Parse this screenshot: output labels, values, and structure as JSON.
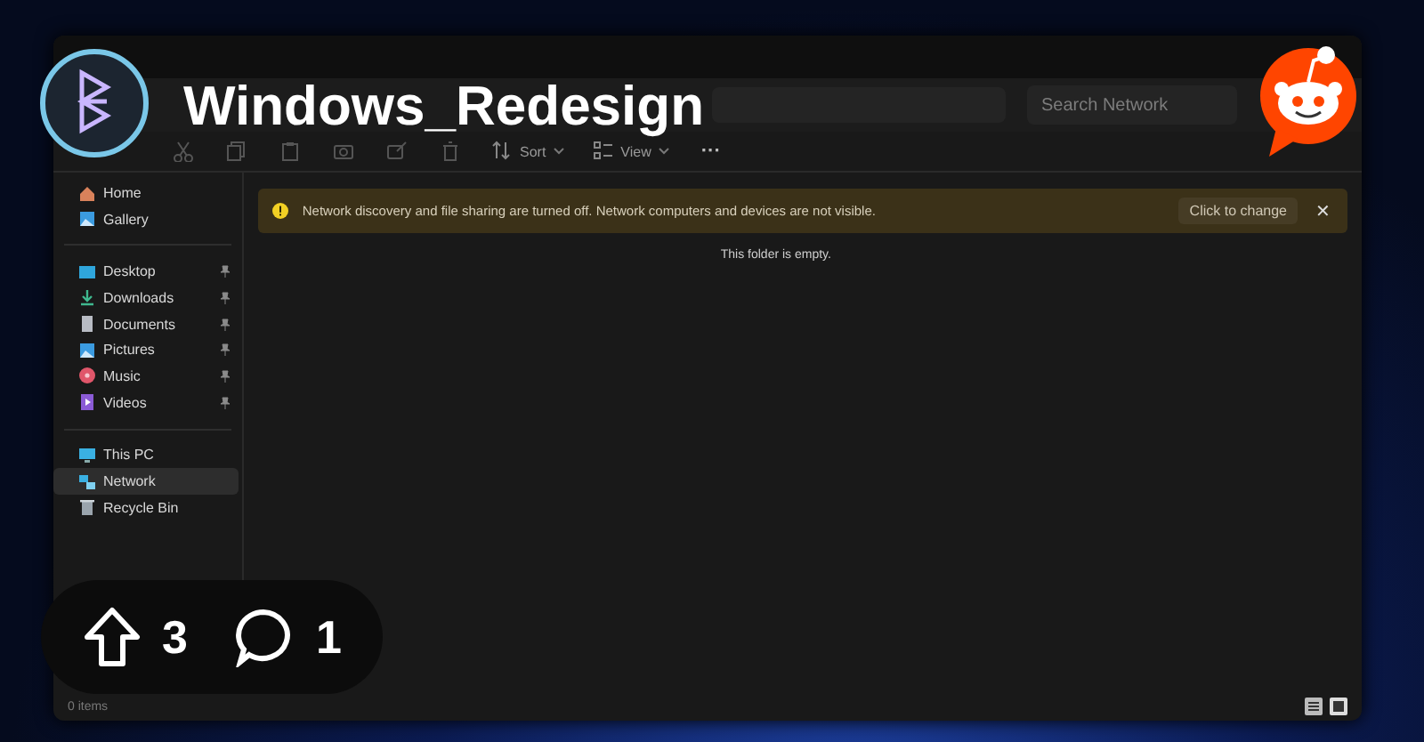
{
  "post": {
    "community": "Windows_Redesign",
    "upvotes": "3",
    "comments": "1"
  },
  "window": {
    "search": {
      "placeholder": "Search Network"
    }
  },
  "toolbar": {
    "items": [
      {
        "kind": "icon"
      },
      {
        "kind": "icon"
      },
      {
        "kind": "icon"
      },
      {
        "kind": "icon"
      },
      {
        "kind": "icon"
      },
      {
        "kind": "icon"
      },
      {
        "kind": "menu",
        "label": "Sort"
      },
      {
        "kind": "menu",
        "label": "View"
      },
      {
        "kind": "more",
        "label": "···"
      }
    ]
  },
  "sidebar": {
    "groups": [
      [
        {
          "label": "Home",
          "pinned": false,
          "selected": false
        },
        {
          "label": "Gallery",
          "pinned": false,
          "selected": false
        }
      ],
      [
        {
          "label": "Desktop",
          "pinned": true,
          "selected": false
        },
        {
          "label": "Downloads",
          "pinned": true,
          "selected": false
        },
        {
          "label": "Documents",
          "pinned": true,
          "selected": false
        },
        {
          "label": "Pictures",
          "pinned": true,
          "selected": false
        },
        {
          "label": "Music",
          "pinned": true,
          "selected": false
        },
        {
          "label": "Videos",
          "pinned": true,
          "selected": false
        }
      ],
      [
        {
          "label": "This PC",
          "pinned": false,
          "selected": false
        },
        {
          "label": "Network",
          "pinned": false,
          "selected": true
        },
        {
          "label": "Recycle Bin",
          "pinned": false,
          "selected": false
        }
      ]
    ]
  },
  "banner": {
    "message": "Network discovery and file sharing are turned off. Network computers and devices are not visible.",
    "action": "Click to change",
    "close": "✕"
  },
  "content": {
    "empty_text": "This folder is empty."
  },
  "status_bar": {
    "text": "0 items"
  }
}
